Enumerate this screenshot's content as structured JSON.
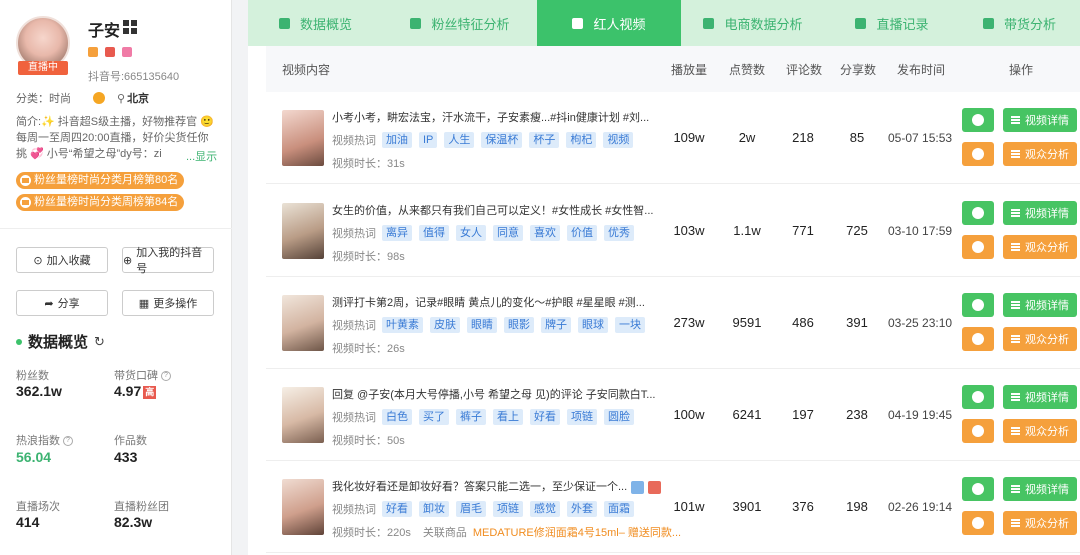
{
  "profile": {
    "name": "子安",
    "live_badge": "直播中",
    "douyin_id": "抖音号:665135640",
    "category": "分类：时尚",
    "location": "北京",
    "intro": "简介:✨ 抖音超S级主播，好物推荐官 🙂 每周一至周四20:00直播，好价尖货任你挑 💞 小号“希望之母”dy号：zi",
    "more_label": "...显示",
    "rank_month": "粉丝量榜时尚分类月榜第80名",
    "rank_week": "粉丝量榜时尚分类周榜第84名",
    "btn_favorite": "加入收藏",
    "btn_add_mine": "加入我的抖音号",
    "btn_share": "分享",
    "btn_more": "更多操作"
  },
  "overview": {
    "title": "数据概览",
    "stats": [
      {
        "label": "粉丝数",
        "value": "362.1w"
      },
      {
        "label": "带货口碑",
        "value": "4.97",
        "badge": "高"
      },
      {
        "label": "热浪指数",
        "value": "56.04"
      },
      {
        "label": "作品数",
        "value": "433"
      },
      {
        "label": "直播场次",
        "value": "414"
      },
      {
        "label": "直播粉丝团",
        "value": "82.3w"
      }
    ]
  },
  "tabs": [
    {
      "label": "数据概览"
    },
    {
      "label": "粉丝特征分析"
    },
    {
      "label": "红人视频"
    },
    {
      "label": "电商数据分析"
    },
    {
      "label": "直播记录"
    },
    {
      "label": "带货分析"
    }
  ],
  "table": {
    "headers": [
      "视频内容",
      "播放量",
      "点赞数",
      "评论数",
      "分享数",
      "发布时间",
      "操作"
    ],
    "keyword_label": "视频热词",
    "detail_label": "视频详情",
    "analysis_label": "观众分析",
    "rows": [
      {
        "title": "小考小考，畊宏法宝，汗水流干，子安素瘦...#抖in健康计划 #刘...",
        "keywords": [
          "加油",
          "IP",
          "人生",
          "保温杯",
          "杯子",
          "枸杞",
          "视频"
        ],
        "duration": "视频时长：31s",
        "plays": "109w",
        "likes": "2w",
        "comments": "218",
        "shares": "85",
        "time": "05-07 15:53"
      },
      {
        "title": "女生的价值，从来都只有我们自己可以定义！#女性成长 #女性智...",
        "keywords": [
          "离异",
          "值得",
          "女人",
          "同意",
          "喜欢",
          "价值",
          "优秀"
        ],
        "duration": "视频时长：98s",
        "plays": "103w",
        "likes": "1.1w",
        "comments": "771",
        "shares": "725",
        "time": "03-10 17:59"
      },
      {
        "title": "测评打卡第2周，记录#眼睛 黄点儿的变化～#护眼 #星星眼 #测...",
        "keywords": [
          "叶黄素",
          "皮肤",
          "眼睛",
          "眼影",
          "牌子",
          "眼球",
          "一块"
        ],
        "duration": "视频时长：26s",
        "plays": "273w",
        "likes": "9591",
        "comments": "486",
        "shares": "391",
        "time": "03-25 23:10"
      },
      {
        "title": "回复 @子安(本月大号停播,小号 希望之母 见)的评论 子安同款白T...",
        "keywords": [
          "白色",
          "买了",
          "裤子",
          "看上",
          "好看",
          "项链",
          "圆脸"
        ],
        "duration": "视频时长：50s",
        "plays": "100w",
        "likes": "6241",
        "comments": "197",
        "shares": "238",
        "time": "04-19 19:45"
      },
      {
        "title": "我化妆好看还是卸妆好看？答案只能二选一，至少保证一个...",
        "keywords": [
          "好看",
          "卸妆",
          "眉毛",
          "项链",
          "感觉",
          "外套",
          "面霜"
        ],
        "duration": "视频时长：220s",
        "product_label": "关联商品",
        "product": "MEDATURE修润面霜4号15ml– 赠送同款...",
        "plays": "101w",
        "likes": "3901",
        "comments": "376",
        "shares": "198",
        "time": "02-26 19:14"
      }
    ]
  },
  "colors": {
    "green": "#3cc26b",
    "green_light": "#d4f1dc",
    "orange": "#f5a03c",
    "keyword_bg": "#ddebfa",
    "keyword_text": "#3a7bd5"
  }
}
